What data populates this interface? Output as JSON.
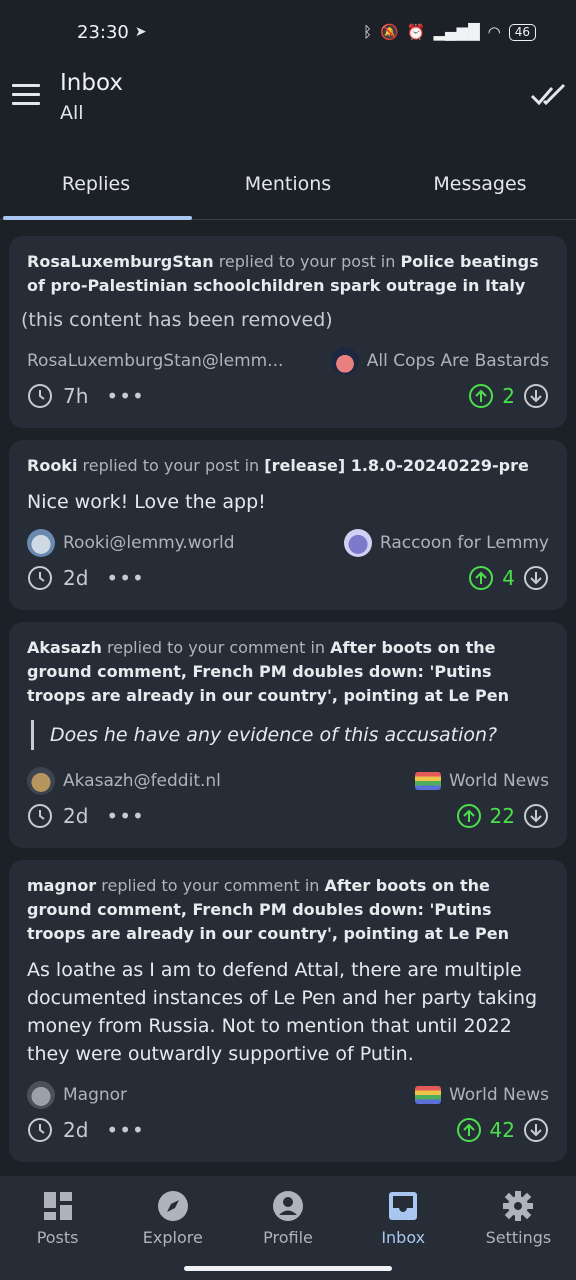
{
  "status": {
    "time": "23:30",
    "battery": "46"
  },
  "header": {
    "title": "Inbox",
    "subtitle": "All"
  },
  "tabs": [
    {
      "label": "Replies",
      "active": true
    },
    {
      "label": "Mentions",
      "active": false
    },
    {
      "label": "Messages",
      "active": false
    }
  ],
  "cards": [
    {
      "author": "RosaLuxemburgStan",
      "action": "replied to your post in",
      "target": "Police beatings of pro-Palestinian schoolchildren spark outrage in Italy",
      "content": "(this content has been removed)",
      "user": "RosaLuxemburgStan@lemm...",
      "community": "All Cops Are Bastards",
      "time": "7h",
      "votes": "2"
    },
    {
      "author": "Rooki",
      "action": "replied to your post in",
      "target": "[release] 1.8.0-20240229-pre",
      "content": "Nice work! Love the app!",
      "user": "Rooki@lemmy.world",
      "community": "Raccoon for Lemmy",
      "time": "2d",
      "votes": "4"
    },
    {
      "author": "Akasazh",
      "action": "replied to your comment in",
      "target": "After boots on the ground comment, French PM doubles down: 'Putins troops are already in our country', pointing at Le Pen",
      "quote": "Does he have any evidence of this accusation?",
      "user": "Akasazh@feddit.nl",
      "community": "World News",
      "time": "2d",
      "votes": "22"
    },
    {
      "author": "magnor",
      "action": "replied to your comment in",
      "target": "After boots on the ground comment, French PM doubles down: 'Putins troops are already in our country', pointing at Le Pen",
      "content": "As loathe as I am to defend Attal, there are multiple documented instances of Le Pen and her party taking money from Russia. Not to mention that until 2022 they were outwardly supportive of Putin.",
      "user": "Magnor",
      "community": "World News",
      "time": "2d",
      "votes": "42"
    }
  ],
  "nav": [
    {
      "label": "Posts",
      "icon": "dashboard-icon"
    },
    {
      "label": "Explore",
      "icon": "compass-icon"
    },
    {
      "label": "Profile",
      "icon": "account-icon"
    },
    {
      "label": "Inbox",
      "icon": "inbox-icon",
      "active": true
    },
    {
      "label": "Settings",
      "icon": "gear-icon"
    }
  ]
}
